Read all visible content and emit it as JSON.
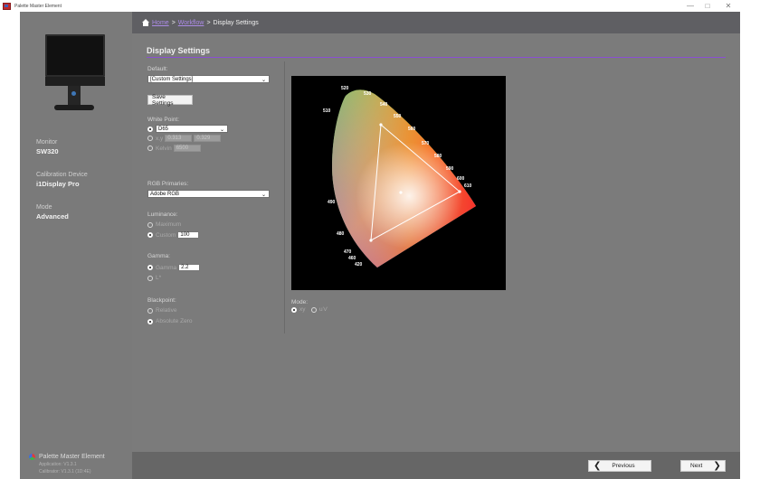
{
  "window": {
    "title": "Palette Master Element",
    "minimize_glyph": "—",
    "maximize_glyph": "□",
    "close_glyph": "✕"
  },
  "sidebar": {
    "monitor_label": "Monitor",
    "monitor_value": "SW320",
    "device_label": "Calibration Device",
    "device_value": "i1Display Pro",
    "mode_label": "Mode",
    "mode_value": "Advanced",
    "app_name": "Palette Master Element",
    "app_version": "Application: V1.3.1",
    "calibrator_version": "Calibrator: V1.3.1 (1D:4E)"
  },
  "breadcrumb": {
    "home": "Home",
    "workflow": "Workflow",
    "current": "Display Settings",
    "separator": ">"
  },
  "page": {
    "title": "Display Settings",
    "accent_color": "#8b4fd3"
  },
  "settings": {
    "default_label": "Default:",
    "default_value": "[Custom Settings]",
    "save_button": "Save Settings",
    "white_point_label": "White Point:",
    "white_point_value": "D65",
    "xy_label": "x,y",
    "xy_x": "0.313",
    "xy_y": "0.329",
    "kelvin_label": "Kelvin",
    "kelvin_value": "6500",
    "rgb_label": "RGB Primaries:",
    "rgb_value": "Adobe RGB",
    "luminance_label": "Luminance:",
    "lum_max": "Maximum",
    "lum_custom": "Custom",
    "lum_custom_value": "100",
    "gamma_label": "Gamma:",
    "gamma_opt": "Gamma",
    "gamma_value": "2.2",
    "gamma_lstar": "L*",
    "blackpoint_label": "Blackpoint:",
    "bp_relative": "Relative",
    "bp_absolute": "Absolute Zero"
  },
  "diagram": {
    "mode_label": "Mode:",
    "mode_xy": "xy",
    "mode_uv": "u'v'",
    "wavelengths": [
      "520",
      "530",
      "540",
      "550",
      "560",
      "570",
      "580",
      "590",
      "600",
      "610",
      "510",
      "490",
      "480",
      "470",
      "460",
      "420"
    ]
  },
  "footer": {
    "previous": "Previous",
    "next": "Next",
    "prev_arrow": "❮",
    "next_arrow": "❯"
  }
}
